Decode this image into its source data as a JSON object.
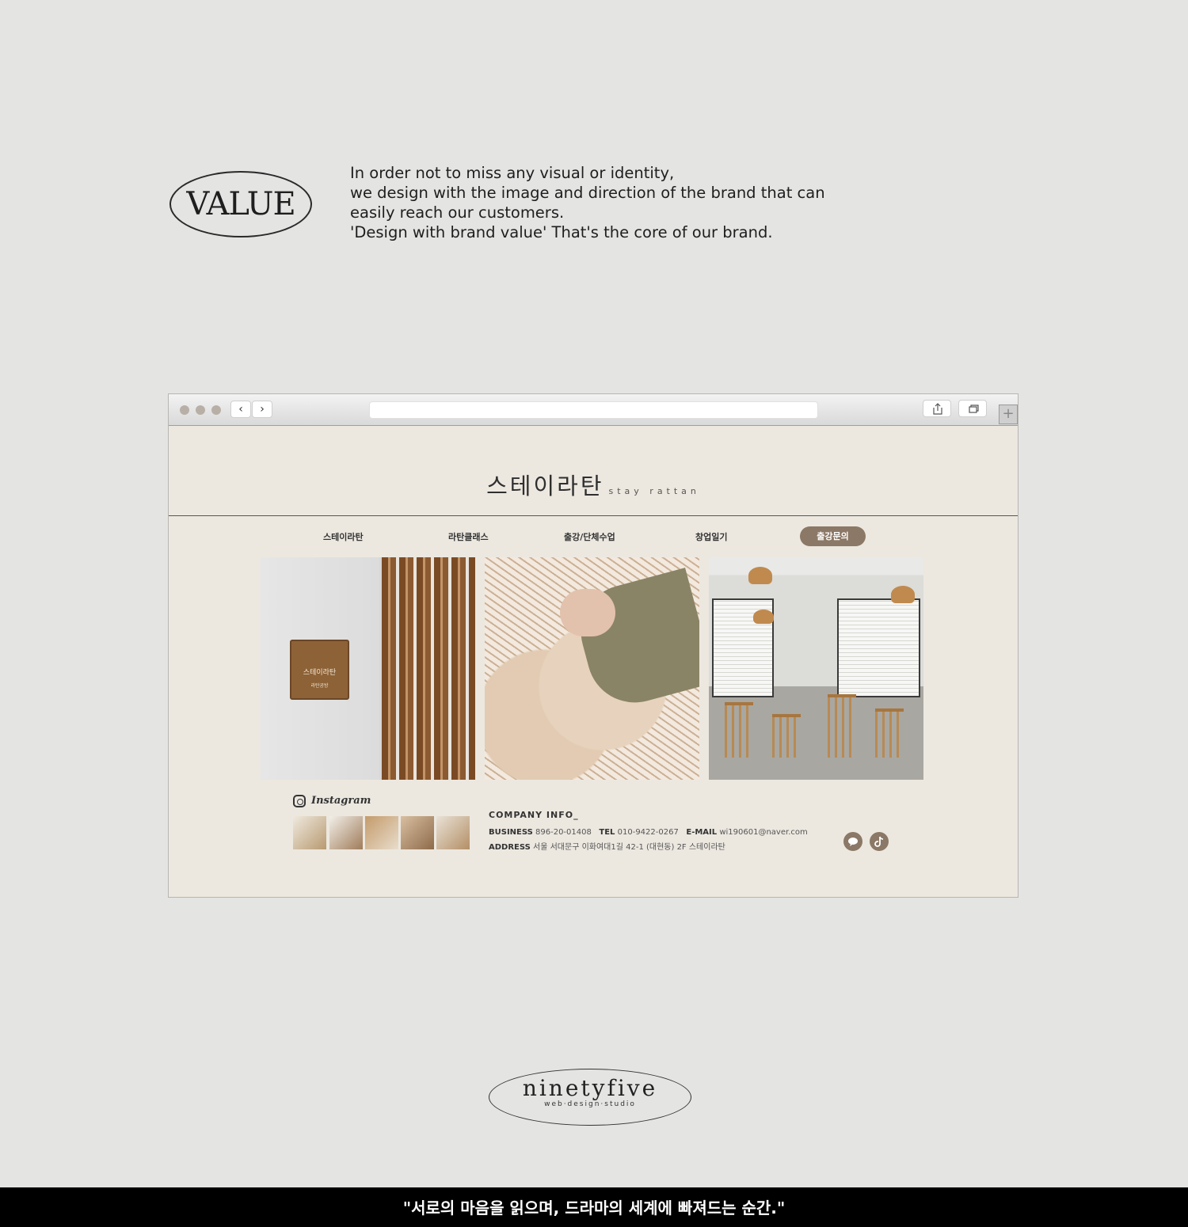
{
  "value": {
    "badge": "VALUE",
    "lines": [
      "In order not to miss any visual or identity,",
      "we design with the image and direction of the brand that can",
      "easily reach our customers.",
      "'Design with brand value' That's the core of our brand."
    ]
  },
  "browser": {
    "nav_back": "‹",
    "nav_forward": "›",
    "new_tab": "+"
  },
  "site": {
    "logo_ko": "스테이라탄",
    "logo_en": "stay rattan",
    "menu": [
      "스테이라탄",
      "라탄클래스",
      "출강/단체수업",
      "창업일기",
      "출강문의"
    ],
    "sign_title": "스테이라탄",
    "sign_sub": "라탄공방",
    "instagram_label": "Instagram",
    "company": {
      "title": "COMPANY INFO_",
      "business_label": "BUSINESS",
      "business": "896-20-01408",
      "tel_label": "TEL",
      "tel": "010-9422-0267",
      "email_label": "E-MAIL",
      "email": "wi190601@naver.com",
      "address_label": "ADDRESS",
      "address": "서울 서대문구 이화여대1길 42-1 (대현동) 2F 스테이라탄"
    },
    "social_icons": [
      "kakao-icon",
      "tiktok-icon"
    ],
    "accent_color": "#8b7866"
  },
  "studio": {
    "name": "ninetyfive",
    "sub": "web·design·studio"
  },
  "caption": "\"서로의 마음을 읽으며, 드라마의 세계에 빠져드는 순간.\""
}
